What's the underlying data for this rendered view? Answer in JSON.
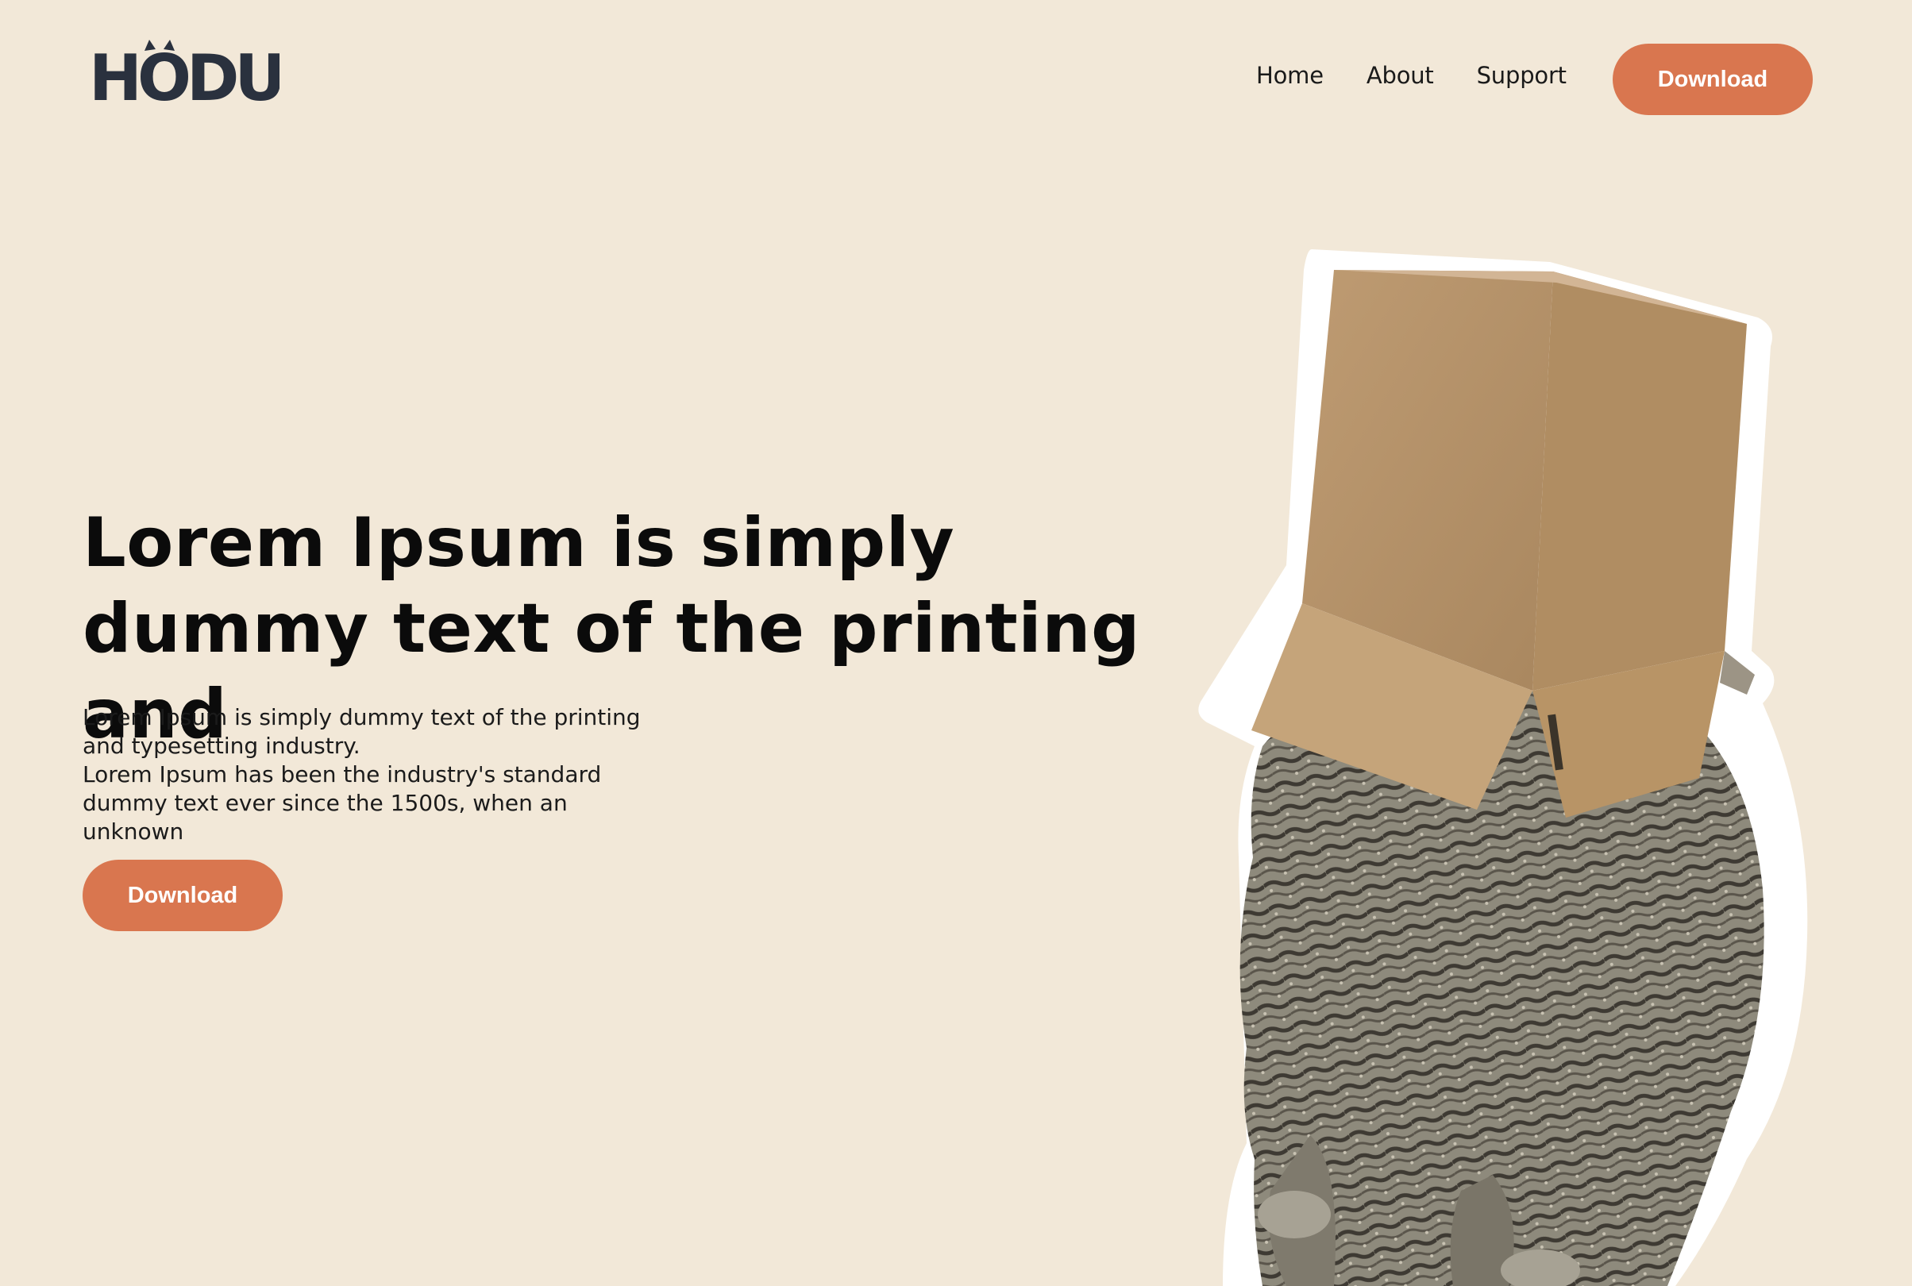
{
  "header": {
    "logo_text": "HODU",
    "nav": [
      {
        "label": "Home"
      },
      {
        "label": "About"
      },
      {
        "label": "Support"
      }
    ],
    "download_label": "Download"
  },
  "hero": {
    "title_line1": "Lorem Ipsum is simply",
    "title_line2": "dummy text of the printing and",
    "desc_line1": "Lorem Ipsum is simply dummy text of the printing and typesetting industry.",
    "desc_line2": "Lorem Ipsum has been the industry's standard dummy text ever since the 1500s, when an unknown",
    "download_label": "Download"
  },
  "illustration": {
    "name": "cat-with-box-on-head-icon"
  },
  "colors": {
    "background": "#F2E8D8",
    "accent": "#D9764F",
    "logo": "#2A313E",
    "text": "#111111"
  }
}
